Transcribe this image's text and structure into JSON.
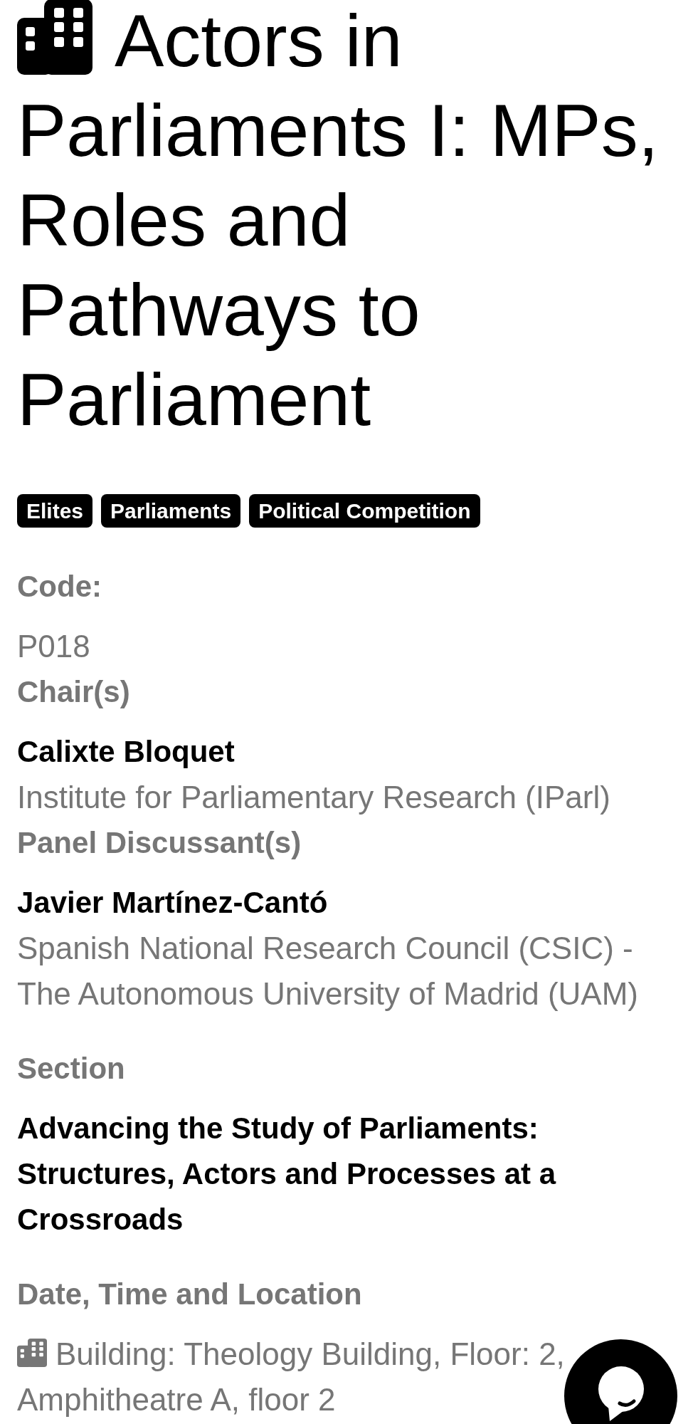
{
  "title": {
    "lines": [
      "Actors in",
      "Parliaments I: MPs, Roles and Pathways to Parliament"
    ]
  },
  "tags": [
    "Elites",
    "Parliaments",
    "Political Competition"
  ],
  "code": {
    "label": "Code:",
    "value": "P018"
  },
  "chairs": {
    "label": "Chair(s)",
    "people": [
      {
        "name": "Calixte Bloquet",
        "affiliation": "Institute for Parliamentary Research (IParl)"
      }
    ]
  },
  "discussants": {
    "label": "Panel Discussant(s)",
    "people": [
      {
        "name": "Javier Martínez-Cantó",
        "affiliation": "Spanish National Research Council (CSIC) - The Autonomous University of Madrid (UAM)"
      }
    ]
  },
  "section": {
    "label": "Section",
    "title": "Advancing the Study of Parliaments: Structures, Actors and Processes at a Crossroads"
  },
  "date_time_location": {
    "label": "Date, Time and Location",
    "location_lines": [
      "Building: Theology Building, Floor: 2,",
      "Amphitheatre A, floor 2"
    ]
  }
}
